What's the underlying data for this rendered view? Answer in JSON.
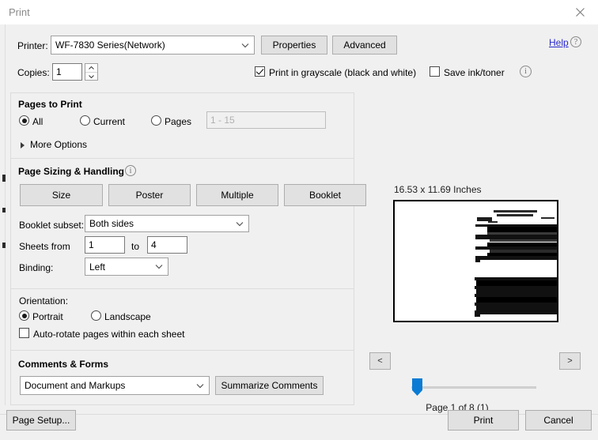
{
  "window": {
    "title": "Print",
    "close_icon": "close-icon"
  },
  "printer": {
    "label": "Printer:",
    "value": "WF-7830 Series(Network)",
    "properties_label": "Properties",
    "advanced_label": "Advanced",
    "help_label": "Help",
    "help_icon": "question-circle-icon"
  },
  "copies": {
    "label": "Copies:",
    "value": "1",
    "up_icon": "spinner-up-icon",
    "down_icon": "spinner-down-icon"
  },
  "options": {
    "grayscale_label": "Print in grayscale (black and white)",
    "grayscale_checked": true,
    "save_ink_label": "Save ink/toner",
    "save_ink_checked": false,
    "info_icon": "info-circle-icon"
  },
  "pages_to_print": {
    "title": "Pages to Print",
    "all_label": "All",
    "current_label": "Current",
    "pages_label": "Pages",
    "selected": "All",
    "range_placeholder": "1 - 15",
    "more_options_label": "More Options",
    "more_options_expanded": false
  },
  "page_sizing": {
    "title": "Page Sizing & Handling",
    "info_icon": "info-circle-icon",
    "buttons": [
      {
        "label": "Size"
      },
      {
        "label": "Poster"
      },
      {
        "label": "Multiple"
      },
      {
        "label": "Booklet"
      }
    ],
    "booklet_subset_label": "Booklet subset:",
    "booklet_subset_value": "Both sides",
    "sheets_from_label": "Sheets from",
    "sheets_from_value": "1",
    "sheets_to_label": "to",
    "sheets_to_value": "4",
    "binding_label": "Binding:",
    "binding_value": "Left"
  },
  "orientation": {
    "title": "Orientation:",
    "portrait_label": "Portrait",
    "landscape_label": "Landscape",
    "selected": "Portrait",
    "auto_rotate_label": "Auto-rotate pages within each sheet",
    "auto_rotate_checked": false
  },
  "comments_forms": {
    "title": "Comments & Forms",
    "value": "Document and Markups",
    "summarize_label": "Summarize Comments"
  },
  "preview": {
    "size_text": "16.53 x 11.69 Inches",
    "page_label": "Page 1 of 8 (1)",
    "prev_label": "<",
    "next_label": ">",
    "slider_position_percent": 4
  },
  "footer": {
    "page_setup_label": "Page Setup...",
    "print_label": "Print",
    "cancel_label": "Cancel"
  },
  "colors": {
    "accent": "#0a7bd4",
    "link": "#2a2ad0",
    "dialog_bg": "#f0f0f0",
    "button_bg": "#e1e1e1"
  }
}
